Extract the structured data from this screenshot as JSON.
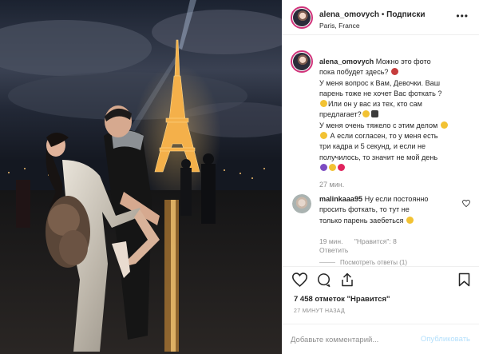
{
  "header": {
    "username": "alena_omovych",
    "separator": "•",
    "follow_label": "Подписки",
    "location": "Paris, France",
    "more_label": "•••"
  },
  "caption": {
    "username": "alena_omovych",
    "lines": [
      "Можно это фото",
      "пока побудет здесь?",
      "У меня вопрос к Вам, Девочки. Ваш",
      "парень тоже не хочет Вас фоткать ?",
      "Или он у вас из тех, кто сам",
      "предлагает?",
      "У меня очень тяжело с этим делом",
      "А если согласен, то у меня есть",
      "три кадра и 5 секунд, и если не",
      "получилось, то значит не мой день"
    ],
    "time": "27 мин."
  },
  "comment": {
    "username": "malinkaaa95",
    "text_lines": [
      "Ну если постоянно",
      "просить фоткать, то тут не",
      "только парень заебеться"
    ],
    "time": "19 мин.",
    "likes": "\"Нравится\": 8",
    "reply_label": "Ответить",
    "view_replies": "Посмотреть ответы (1)"
  },
  "actions": {
    "like_icon": "heart-outline-icon",
    "comment_icon": "comment-bubble-icon",
    "share_icon": "share-arrow-icon",
    "save_icon": "bookmark-icon",
    "likes_text": "7 458 отметок \"Нравится\"",
    "posted_time": "27 МИНУТ НАЗАД"
  },
  "add_comment": {
    "placeholder": "Добавьте комментарий...",
    "publish_label": "Опубликовать"
  },
  "colors": {
    "accent_disabled": "#b2dffc",
    "muted": "#8e8e8e",
    "story_ring": "#d0337a"
  }
}
